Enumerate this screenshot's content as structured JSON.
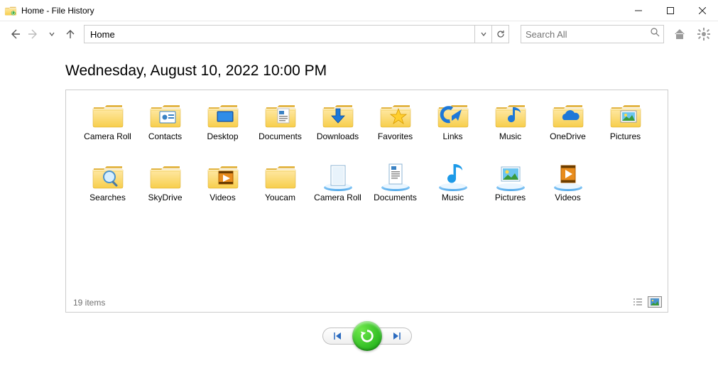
{
  "window": {
    "title": "Home - File History"
  },
  "nav": {
    "address": "Home",
    "search_placeholder": "Search All"
  },
  "main": {
    "timestamp": "Wednesday, August 10, 2022 10:00 PM",
    "items": [
      {
        "label": "Camera Roll",
        "icon": "folder"
      },
      {
        "label": "Contacts",
        "icon": "folder-contacts"
      },
      {
        "label": "Desktop",
        "icon": "folder-desktop"
      },
      {
        "label": "Documents",
        "icon": "folder-documents"
      },
      {
        "label": "Downloads",
        "icon": "folder-downloads"
      },
      {
        "label": "Favorites",
        "icon": "folder-favorites"
      },
      {
        "label": "Links",
        "icon": "folder-links"
      },
      {
        "label": "Music",
        "icon": "folder-music"
      },
      {
        "label": "OneDrive",
        "icon": "folder-onedrive"
      },
      {
        "label": "Pictures",
        "icon": "folder-pictures"
      },
      {
        "label": "Searches",
        "icon": "folder-searches"
      },
      {
        "label": "SkyDrive",
        "icon": "folder"
      },
      {
        "label": "Videos",
        "icon": "folder-videos"
      },
      {
        "label": "Youcam",
        "icon": "folder"
      },
      {
        "label": "Camera Roll",
        "icon": "library"
      },
      {
        "label": "Documents",
        "icon": "library-documents"
      },
      {
        "label": "Music",
        "icon": "library-music"
      },
      {
        "label": "Pictures",
        "icon": "library-pictures"
      },
      {
        "label": "Videos",
        "icon": "library-videos"
      }
    ],
    "item_count_label": "19 items"
  }
}
